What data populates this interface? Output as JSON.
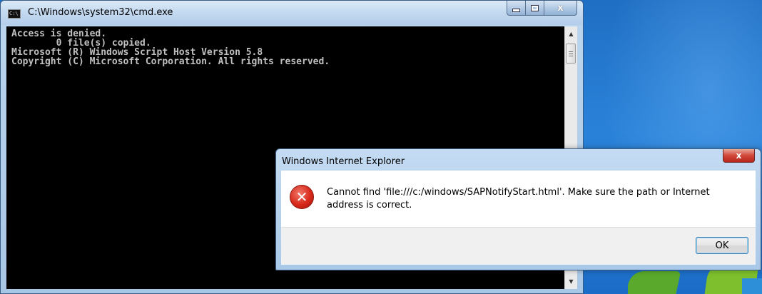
{
  "cmd_window": {
    "title": "C:\\Windows\\system32\\cmd.exe",
    "app_icon_text": "C:\\",
    "console_lines": [
      "Access is denied.",
      "        0 file(s) copied.",
      "Microsoft (R) Windows Script Host Version 5.8",
      "Copyright (C) Microsoft Corporation. All rights reserved."
    ],
    "close_label": "x"
  },
  "ie_dialog": {
    "title": "Windows Internet Explorer",
    "message": "Cannot find 'file:///c:/windows/SAPNotifyStart.html'. Make sure the path or Internet address is correct.",
    "ok_label": "OK",
    "close_label": "x",
    "error_icon_glyph": "✕"
  },
  "icons": {
    "app_icon": "cmd-console-icon",
    "error_icon": "error-icon",
    "close_icon": "close-icon",
    "minimize_icon": "minimize-icon",
    "maximize_icon": "maximize-icon"
  },
  "colors": {
    "console_bg": "#000000",
    "console_text": "#c0c0c0",
    "desktop_blue": "#2a82d8",
    "error_red": "#d8291b",
    "dialog_close_red": "#d0473a"
  }
}
